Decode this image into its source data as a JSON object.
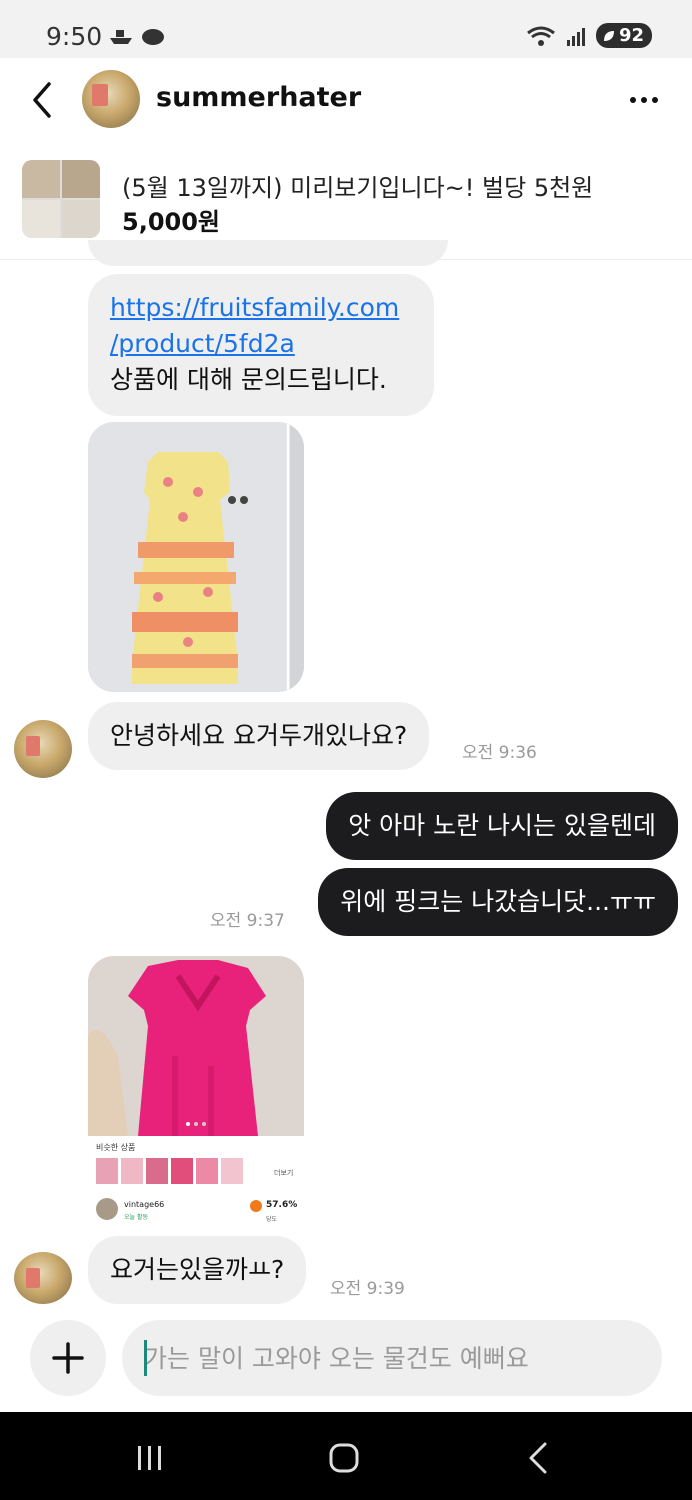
{
  "status_bar": {
    "time": "9:50",
    "battery": "92"
  },
  "header": {
    "username": "summerhater"
  },
  "product": {
    "title": "(5월 13일까지) 미리보기입니다~! 벌당 5천원",
    "price": "5,000원"
  },
  "messages": {
    "link_message": {
      "link_line1": "https://fruitsfamily.com",
      "link_line2": "/product/5fd2a",
      "text": "상품에 대해 문의드립니다."
    },
    "msg1": {
      "text": "안녕하세요 요거두개있나요?",
      "time": "오전 9:36"
    },
    "msg2": {
      "text": "앗 아마 노란 나시는 있을텐데"
    },
    "msg3": {
      "text": "위에 핑크는 나갔습니닷...ㅠㅠ",
      "time": "오전 9:37"
    },
    "screenshot": {
      "section_title": "비슷한 상품",
      "more": "더보기",
      "seller": "vintage66",
      "seller_status": "오늘 활동",
      "rating": "57.6%",
      "rating_label": "당도"
    },
    "msg4": {
      "text": "요거는있을까ㅛ?",
      "time": "오전 9:39"
    }
  },
  "composer": {
    "placeholder": "가는 말이 고와야 오는 물건도 예뻐요"
  },
  "colors": {
    "outgoing_bubble": "#1c1c1e",
    "incoming_bubble": "#efefef",
    "link": "#1a73e8"
  }
}
